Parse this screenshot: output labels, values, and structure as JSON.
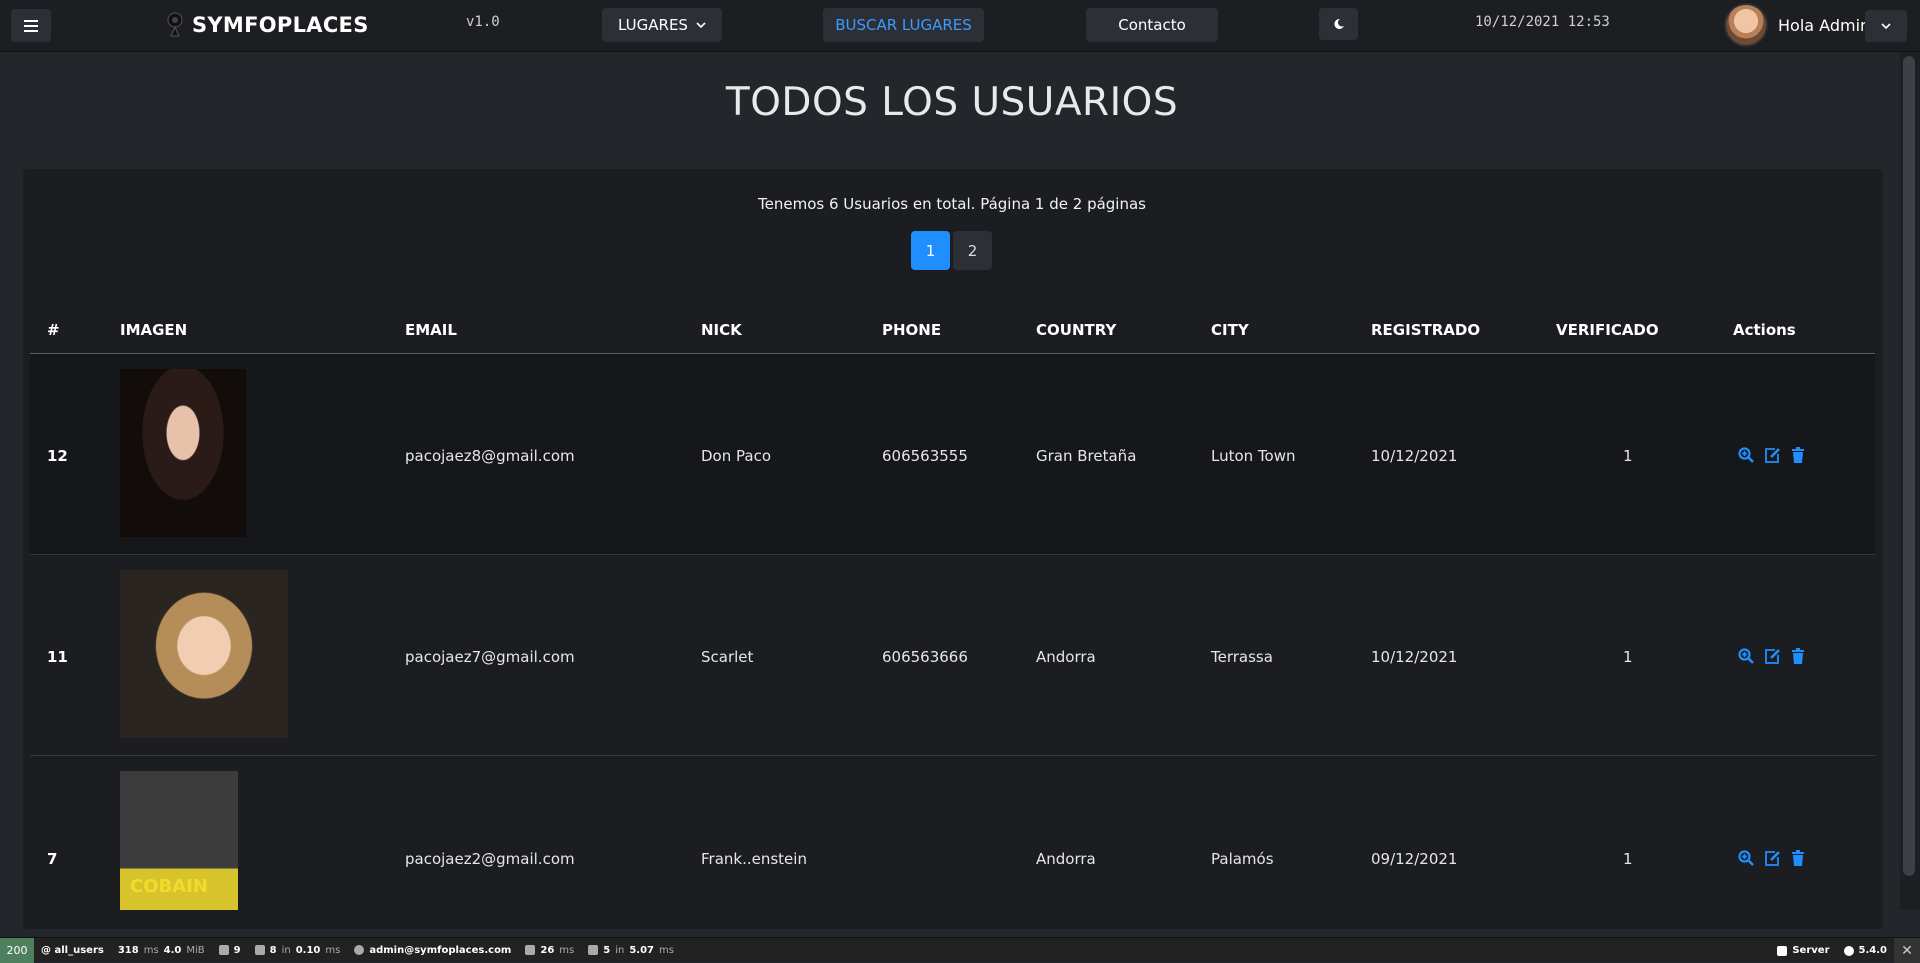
{
  "navbar": {
    "brand": "SYMFOPLACES",
    "version": "v1.0",
    "lugares": "LUGARES",
    "buscar": "BUSCAR LUGARES",
    "contacto": "Contacto",
    "datetime": "10/12/2021 12:53",
    "greeting": "Hola Admin"
  },
  "page": {
    "title": "TODOS LOS USUARIOS",
    "summary": "Tenemos 6 Usuarios en total. Página 1 de 2 páginas",
    "pages": [
      "1",
      "2"
    ],
    "active_page": "1"
  },
  "table": {
    "headers": [
      "#",
      "IMAGEN",
      "EMAIL",
      "NICK",
      "PHONE",
      "COUNTRY",
      "CITY",
      "REGISTRADO",
      "VERIFICADO",
      "Actions"
    ],
    "rows": [
      {
        "id": "12",
        "email": "pacojaez8@gmail.com",
        "nick": "Don Paco",
        "phone": "606563555",
        "country": "Gran Bretaña",
        "city": "Luton Town",
        "registered": "10/12/2021",
        "verified": "1"
      },
      {
        "id": "11",
        "email": "pacojaez7@gmail.com",
        "nick": "Scarlet",
        "phone": "606563666",
        "country": "Andorra",
        "city": "Terrassa",
        "registered": "10/12/2021",
        "verified": "1"
      },
      {
        "id": "7",
        "email": "pacojaez2@gmail.com",
        "nick": "Frank..enstein",
        "phone": "",
        "country": "Andorra",
        "city": "Palamós",
        "registered": "09/12/2021",
        "verified": "1"
      }
    ],
    "poster_text": "COBAIN"
  },
  "debug_bar": {
    "status": "200",
    "route": "@ all_users",
    "time": "318",
    "time_unit": "ms",
    "memory": "4.0",
    "memory_unit": "MiB",
    "logs": "9",
    "cache": "8",
    "cache_in": "in",
    "cache_time": "0.10",
    "cache_unit": "ms",
    "user": "admin@symfoplaces.com",
    "twig": "26",
    "twig_unit": "ms",
    "db": "5",
    "db_in": "in",
    "db_time": "5.07",
    "db_unit": "ms",
    "server": "Server",
    "symfony_version": "5.4.0"
  },
  "colors": {
    "accent": "#1f8fff",
    "link": "#3d9bff",
    "background": "#23262b",
    "card": "#1b1d21",
    "navbar": "#1c1e22",
    "debug_ok": "#4f805d"
  },
  "icons": {
    "menu": "hamburger-icon",
    "brand": "map-pin-icon",
    "theme": "moon-icon",
    "caret": "chevron-down-icon",
    "view": "zoom-in-icon",
    "edit": "edit-icon",
    "delete": "trash-icon",
    "close": "close-icon"
  }
}
